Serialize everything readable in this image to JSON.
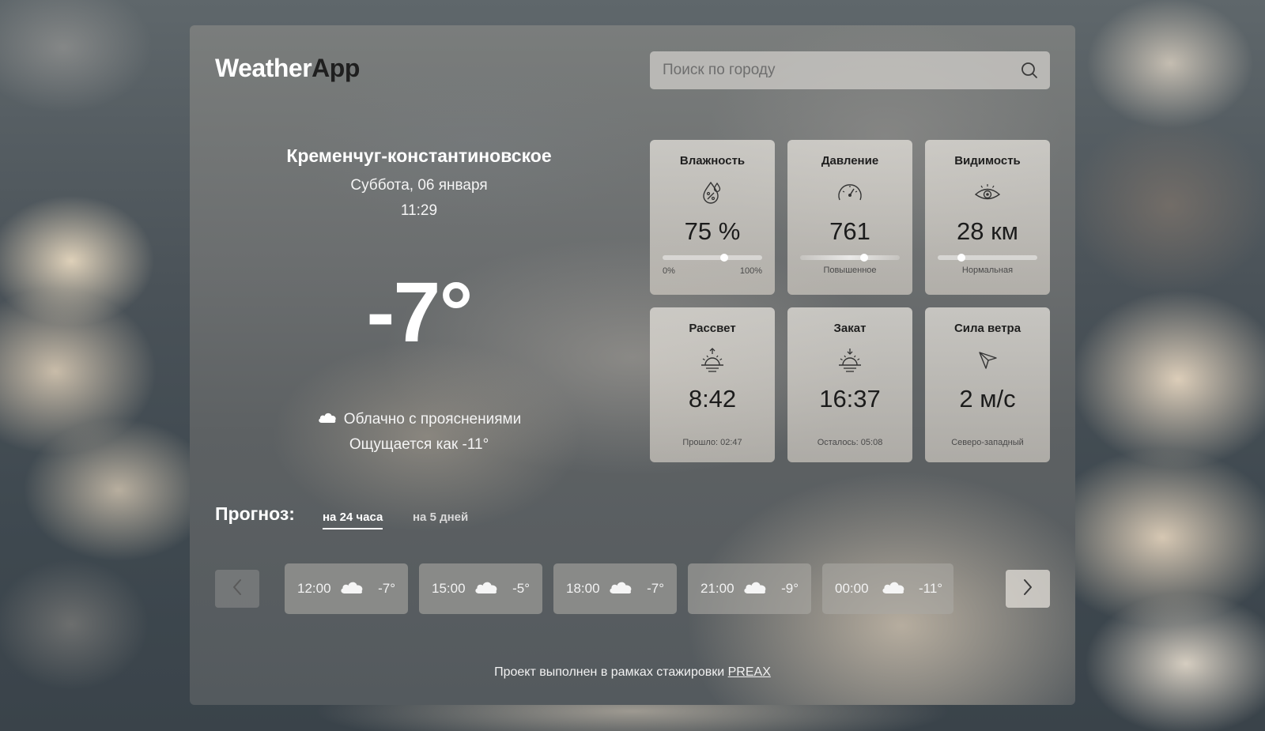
{
  "app": {
    "logo_part1": "Weather",
    "logo_part2": "App"
  },
  "search": {
    "placeholder": "Поиск по городу",
    "icon": "search-icon"
  },
  "current": {
    "city": "Кременчуг-константиновское",
    "date": "Суббота, 06 января",
    "time": "11:29",
    "temperature": "-7°",
    "condition": "Облачно с прояснениями",
    "condition_icon": "cloud-icon",
    "feels_like": "Ощущается как -11°"
  },
  "stats": [
    {
      "title": "Влажность",
      "icon": "humidity-icon",
      "value": "75 %",
      "min_label": "0%",
      "max_label": "100%",
      "level": 0.62
    },
    {
      "title": "Давление",
      "icon": "gauge-icon",
      "value": "761",
      "note": "Повышенное",
      "level": 0.64
    },
    {
      "title": "Видимость",
      "icon": "eye-icon",
      "value": "28 км",
      "note": "Нормальная",
      "level": 0.24
    },
    {
      "title": "Рассвет",
      "icon": "sunrise-icon",
      "value": "8:42",
      "note": "Прошло: 02:47"
    },
    {
      "title": "Закат",
      "icon": "sunset-icon",
      "value": "16:37",
      "note": "Осталось: 05:08"
    },
    {
      "title": "Сила ветра",
      "icon": "wind-direction-icon",
      "value": "2 м/с",
      "note": "Северо-западный"
    }
  ],
  "forecast": {
    "title": "Прогноз:",
    "tabs": [
      {
        "label": "на 24 часа",
        "active": true
      },
      {
        "label": "на 5 дней",
        "active": false
      }
    ],
    "hours": [
      {
        "time": "12:00",
        "icon": "cloud-icon",
        "temp": "-7°"
      },
      {
        "time": "15:00",
        "icon": "cloud-icon",
        "temp": "-5°"
      },
      {
        "time": "18:00",
        "icon": "cloud-icon",
        "temp": "-7°"
      },
      {
        "time": "21:00",
        "icon": "cloud-icon",
        "temp": "-9°"
      },
      {
        "time": "00:00",
        "icon": "cloud-icon",
        "temp": "-11°"
      }
    ],
    "prev_icon": "chevron-left-icon",
    "next_icon": "chevron-right-icon"
  },
  "footer": {
    "text": "Проект выполнен в рамках стажировки ",
    "link": "PREAX"
  }
}
